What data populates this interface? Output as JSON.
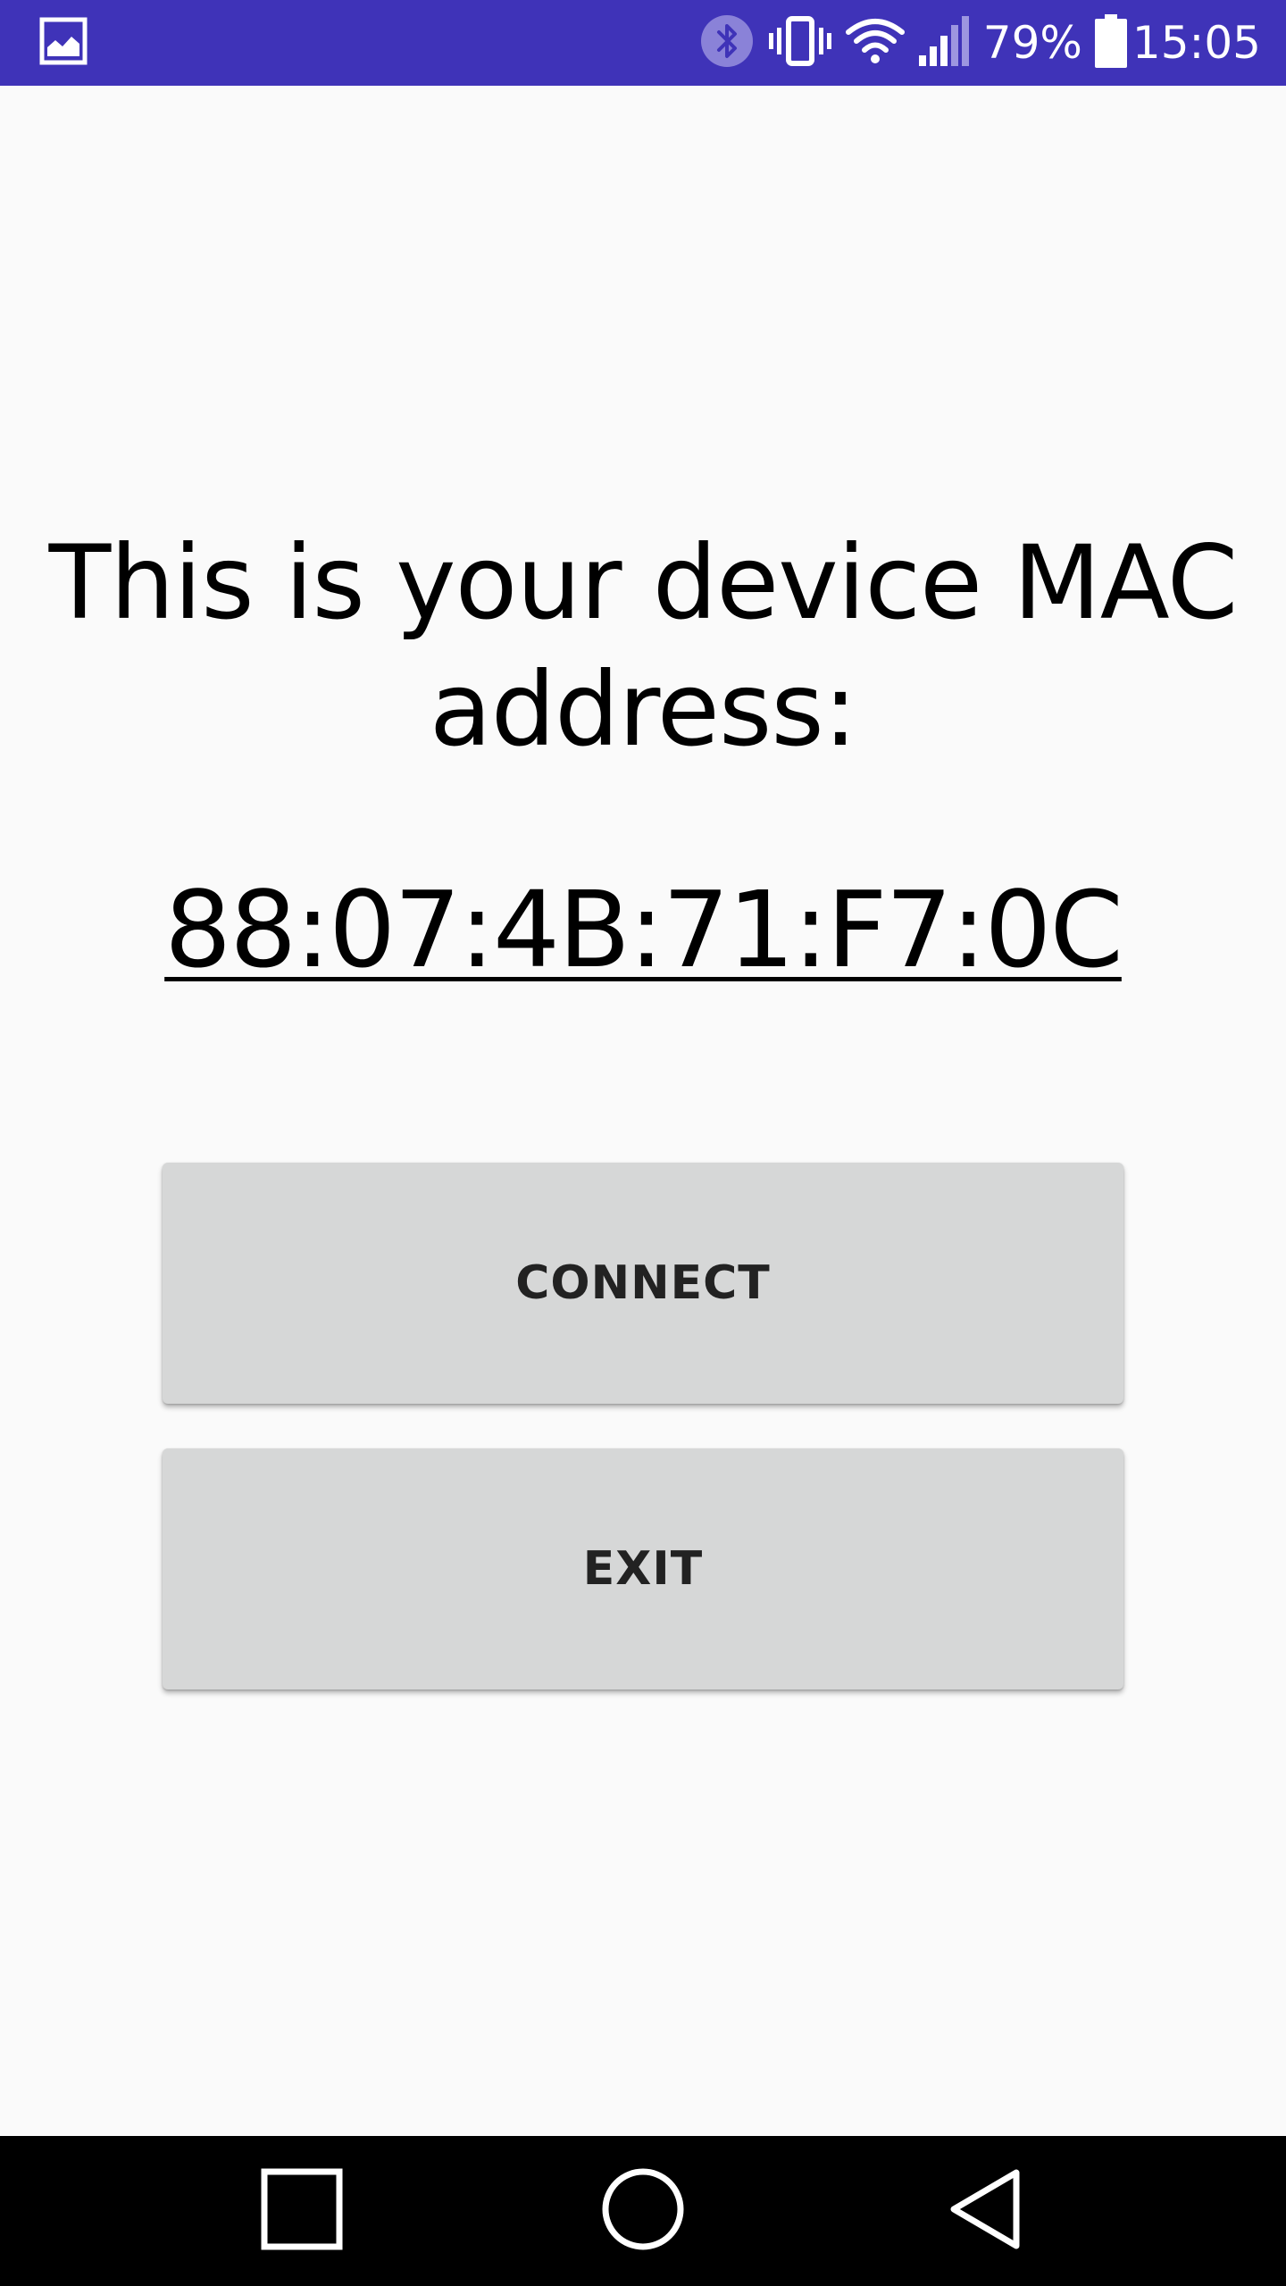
{
  "colors": {
    "status_bar": "#3F33B8",
    "background": "#FAFAFA",
    "button": "#D6D7D7",
    "button_text": "#222222",
    "nav_bar": "#000000"
  },
  "status_bar": {
    "left_icon": "image-notification-icon",
    "icons": [
      "bluetooth-icon",
      "vibrate-icon",
      "wifi-icon",
      "cell-signal-icon"
    ],
    "battery_percent": "79%",
    "battery_icon": "battery-icon",
    "time": "15:05"
  },
  "main": {
    "headline": "This is your device MAC address:",
    "mac_address": "88:07:4B:71:F7:0C"
  },
  "buttons": {
    "connect_label": "CONNECT",
    "exit_label": "EXIT"
  },
  "nav_bar": {
    "items": [
      "recents-square-icon",
      "home-circle-icon",
      "back-triangle-icon"
    ]
  }
}
